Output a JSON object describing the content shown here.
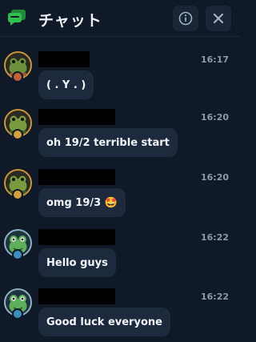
{
  "header": {
    "title": "チャット",
    "chat_icon_color": "#2fbf4e"
  },
  "messages": [
    {
      "avatar": "frog-avatar-gold",
      "time": "16:17",
      "text": "( . Y . )"
    },
    {
      "avatar": "frog-avatar-gold",
      "time": "16:20",
      "text": "oh 19/2 terrible start"
    },
    {
      "avatar": "frog-avatar-gold",
      "time": "16:20",
      "text": "omg 19/3 🤩"
    },
    {
      "avatar": "frog-avatar-silver",
      "time": "16:22",
      "text": "Hello guys"
    },
    {
      "avatar": "frog-avatar-silver",
      "time": "16:22",
      "text": "Good luck everyone"
    }
  ],
  "colors": {
    "background": "#0f1928",
    "bubble": "#1d2a3e",
    "time": "#8c9aab",
    "gold_ring": "#c9953a",
    "silver_ring": "#8fb0c2"
  }
}
